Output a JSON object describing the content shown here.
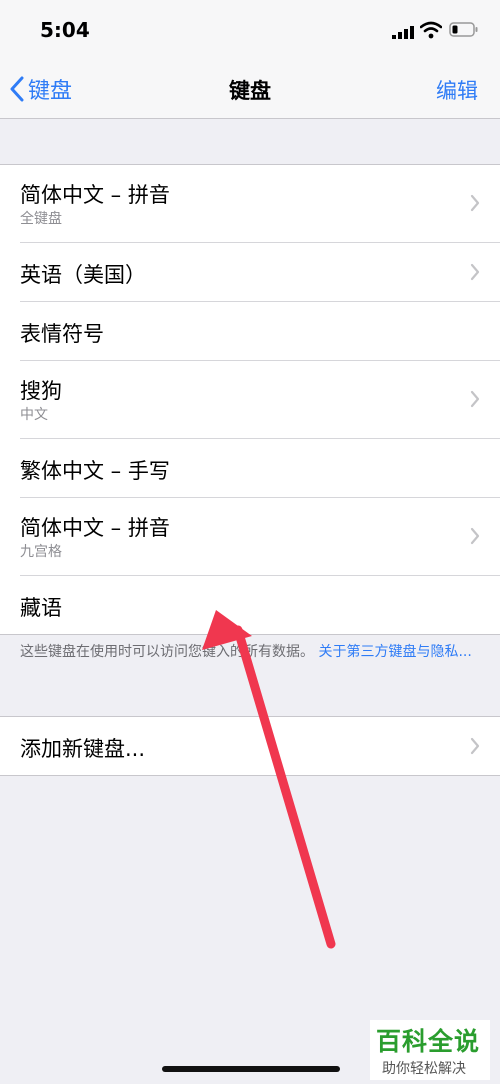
{
  "status": {
    "time": "5:04"
  },
  "nav": {
    "back_label": "键盘",
    "title": "键盘",
    "edit_label": "编辑"
  },
  "keyboards": [
    {
      "name": "简体中文 – 拼音",
      "subtitle": "全键盘",
      "chevron": true
    },
    {
      "name": "英语（美国）",
      "subtitle": "",
      "chevron": true
    },
    {
      "name": "表情符号",
      "subtitle": "",
      "chevron": false
    },
    {
      "name": "搜狗",
      "subtitle": "中文",
      "chevron": true
    },
    {
      "name": "繁体中文 – 手写",
      "subtitle": "",
      "chevron": false
    },
    {
      "name": "简体中文 – 拼音",
      "subtitle": "九宫格",
      "chevron": true
    },
    {
      "name": "藏语",
      "subtitle": "",
      "chevron": false
    }
  ],
  "footer": {
    "text": "这些键盘在使用时可以访问您键入的所有数据。",
    "link": "关于第三方键盘与隐私..."
  },
  "add": {
    "label": "添加新键盘..."
  },
  "watermark": {
    "title": "百科全说",
    "subtitle": "助你轻松解决"
  },
  "colors": {
    "accent": "#2f7cf6",
    "arrow": "#f0374f",
    "watermark": "#2a9d2e"
  }
}
